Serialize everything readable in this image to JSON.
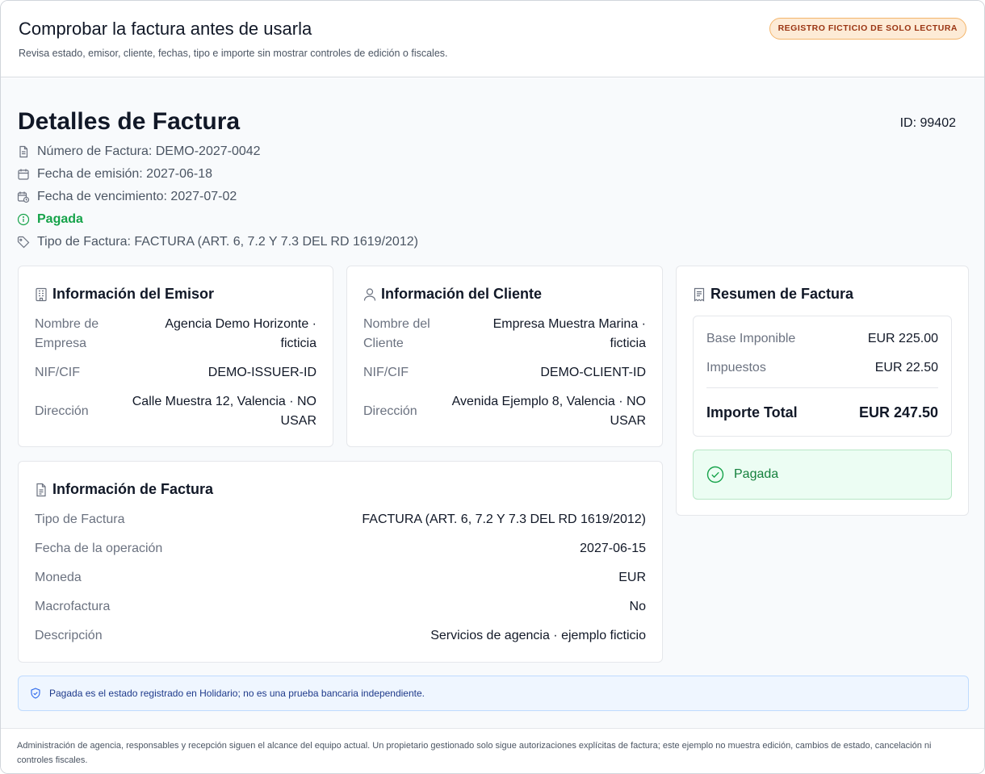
{
  "header": {
    "title": "Comprobar la factura antes de usarla",
    "subtitle": "Revisa estado, emisor, cliente, fechas, tipo e importe sin mostrar controles de edición o fiscales.",
    "badge": "Registro ficticio de solo lectura"
  },
  "invoice": {
    "page_title": "Detalles de Factura",
    "id_label": "ID: 99402",
    "number": "Número de Factura: DEMO-2027-0042",
    "issue_date": "Fecha de emisión: 2027-06-18",
    "due_date": "Fecha de vencimiento: 2027-07-02",
    "status": "Pagada",
    "type": "Tipo de Factura: FACTURA (ART. 6, 7.2 Y 7.3 DEL RD 1619/2012)"
  },
  "issuer": {
    "title": "Información del Emisor",
    "rows": [
      {
        "label": "Nombre de Empresa",
        "value": "Agencia Demo Horizonte · ficticia"
      },
      {
        "label": "NIF/CIF",
        "value": "DEMO-ISSUER-ID"
      },
      {
        "label": "Dirección",
        "value": "Calle Muestra 12, Valencia · NO USAR"
      }
    ]
  },
  "client": {
    "title": "Información del Cliente",
    "rows": [
      {
        "label": "Nombre del Cliente",
        "value": "Empresa Muestra Marina · ficticia"
      },
      {
        "label": "NIF/CIF",
        "value": "DEMO-CLIENT-ID"
      },
      {
        "label": "Dirección",
        "value": "Avenida Ejemplo 8, Valencia · NO USAR"
      }
    ]
  },
  "details": {
    "title": "Información de Factura",
    "rows": [
      {
        "label": "Tipo de Factura",
        "value": "FACTURA (ART. 6, 7.2 Y 7.3 DEL RD 1619/2012)"
      },
      {
        "label": "Fecha de la operación",
        "value": "2027-06-15"
      },
      {
        "label": "Moneda",
        "value": "EUR"
      },
      {
        "label": "Macrofactura",
        "value": "No"
      },
      {
        "label": "Descripción",
        "value": "Servicios de agencia · ejemplo ficticio"
      }
    ]
  },
  "summary": {
    "title": "Resumen de Factura",
    "base_label": "Base Imponible",
    "base_value": "EUR 225.00",
    "tax_label": "Impuestos",
    "tax_value": "EUR 22.50",
    "total_label": "Importe Total",
    "total_value": "EUR 247.50",
    "status": "Pagada"
  },
  "notice": "Pagada es el estado registrado en Holidario; no es una prueba bancaria independiente.",
  "footer": "Administración de agencia, responsables y recepción siguen el alcance del equipo actual. Un propietario gestionado solo sigue autorizaciones explícitas de factura; este ejemplo no muestra edición, cambios de estado, cancelación ni controles fiscales.",
  "icons": {
    "number": "document-icon",
    "issue_date": "calendar-icon",
    "due_date": "calendar-clock-icon",
    "status": "info-circle-icon",
    "type": "tag-icon",
    "issuer": "building-icon",
    "client": "user-icon",
    "details": "file-text-icon",
    "summary": "receipt-icon",
    "paid": "check-circle-icon",
    "notice": "shield-check-icon"
  },
  "colors": {
    "badge_bg": "#fdebd6",
    "badge_text": "#9a3412",
    "paid_green": "#16a34a",
    "paid_bg": "#ecfdf3",
    "notice_bg": "#eff6ff",
    "notice_text": "#1e3a8a"
  }
}
